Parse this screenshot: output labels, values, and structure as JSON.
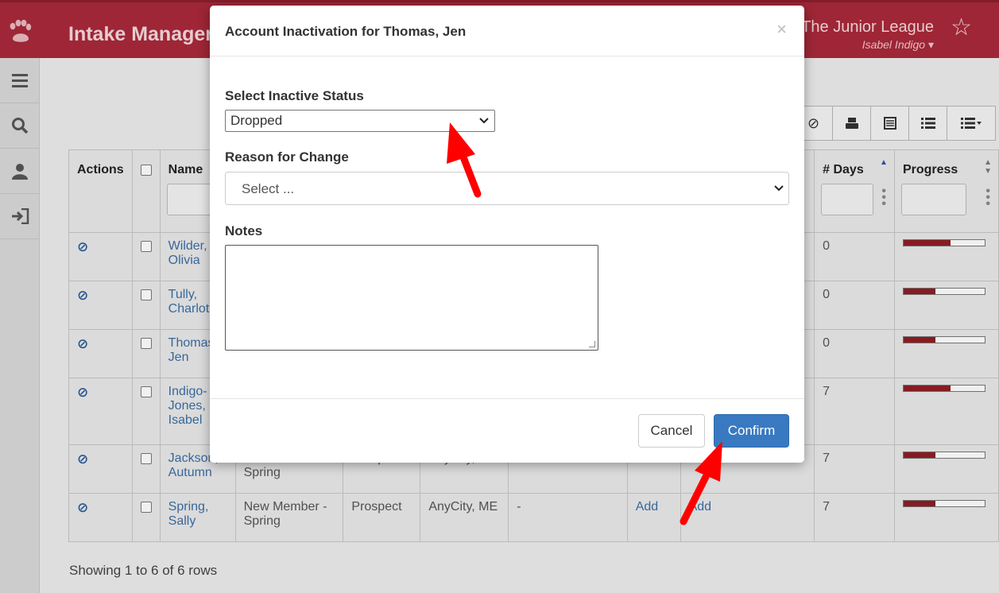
{
  "header": {
    "app_title": "Intake Manager",
    "org_name": "The Junior League",
    "user_name": "Isabel Indigo ▾"
  },
  "sidebar": {
    "items": [
      {
        "icon": "menu-icon"
      },
      {
        "icon": "search-icon"
      },
      {
        "icon": "user-icon"
      },
      {
        "icon": "sign-in-icon"
      }
    ]
  },
  "table": {
    "headers": {
      "actions": "Actions",
      "name": "Name",
      "days": "# Days",
      "progress": "Progress"
    },
    "rows": [
      {
        "name": "Wilder, Olivia",
        "type": "",
        "stage": "",
        "city": "",
        "extra": "",
        "add1": "",
        "add2": "",
        "days": "0",
        "progress": 0.58
      },
      {
        "name": "Tully, Charlott",
        "type": "",
        "stage": "",
        "city": "",
        "extra": "",
        "add1": "",
        "add2": "",
        "days": "0",
        "progress": 0.39
      },
      {
        "name": "Thomas, Jen",
        "type": "",
        "stage": "",
        "city": "",
        "extra": "",
        "add1": "",
        "add2": "",
        "days": "0",
        "progress": 0.39
      },
      {
        "name": "Indigo-Jones, Isabel",
        "type": "",
        "stage": "",
        "city": "",
        "extra": "",
        "add1": "",
        "add2": "",
        "days": "7",
        "progress": 0.58
      },
      {
        "name": "Jackson, Autumn",
        "type": "New Member - Spring",
        "stage": "Prospect",
        "city": "AnyCity, ME",
        "extra": "",
        "add1": "Add",
        "add2": "Add",
        "days": "7",
        "progress": 0.39
      },
      {
        "name": "Spring, Sally",
        "type": "New Member - Spring",
        "stage": "Prospect",
        "city": "AnyCity, ME",
        "extra": "-",
        "add1": "Add",
        "add2": "Add",
        "days": "7",
        "progress": 0.39
      }
    ],
    "footer": "Showing 1 to 6 of 6 rows"
  },
  "modal": {
    "title": "Account Inactivation for Thomas, Jen",
    "close": "×",
    "status_label": "Select Inactive Status",
    "status_value": "Dropped",
    "reason_label": "Reason for Change",
    "reason_value": "Select ...",
    "notes_label": "Notes",
    "notes_value": "",
    "cancel_label": "Cancel",
    "confirm_label": "Confirm"
  },
  "colors": {
    "brand": "#a8293a",
    "progress_fill": "#8f1e26",
    "confirm": "#3879c1",
    "annotation_arrow": "#ff0000"
  }
}
